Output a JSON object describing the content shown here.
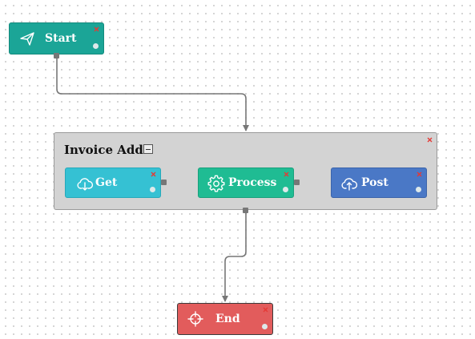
{
  "nodes": {
    "start": {
      "label": "Start",
      "icon": "paper-plane-icon",
      "color": "#1ba597"
    },
    "get": {
      "label": "Get",
      "icon": "cloud-download-icon",
      "color": "#35c1d3"
    },
    "process": {
      "label": "Process",
      "icon": "gear-icon",
      "color": "#1fbc93"
    },
    "post": {
      "label": "Post",
      "icon": "cloud-upload-icon",
      "color": "#4a78c6"
    },
    "end": {
      "label": "End",
      "icon": "crosshair-icon",
      "color": "#e25c5c"
    }
  },
  "group": {
    "title": "Invoice Add",
    "collapse_icon": "minus-box-icon",
    "background": "#d3d3d3"
  },
  "close_color": "#e53935",
  "connector_color": "#777777"
}
